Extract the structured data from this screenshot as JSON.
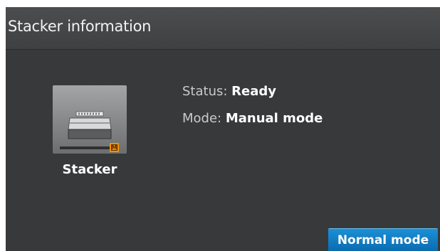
{
  "header": {
    "title": "Stacker information"
  },
  "device": {
    "label": "Stacker",
    "icon": "stacker-icon",
    "badge_letter": "M"
  },
  "info": {
    "status_label": "Status:",
    "status_value": "Ready",
    "mode_label": "Mode:",
    "mode_value": "Manual mode"
  },
  "actions": {
    "normal_mode_label": "Normal mode"
  },
  "colors": {
    "accent": "#0a6cb0",
    "badge": "#f39200",
    "background": "#37393b"
  }
}
